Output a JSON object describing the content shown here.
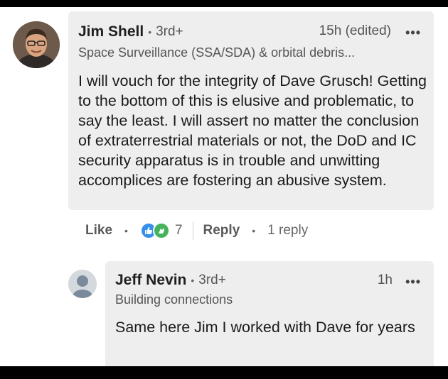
{
  "comment": {
    "author": "Jim Shell",
    "separator": "•",
    "degree": "3rd+",
    "time": "15h (edited)",
    "more": "•••",
    "headline": "Space Surveillance (SSA/SDA) & orbital debris...",
    "text": "I will vouch for the integrity of Dave Grusch! Getting to the bottom of this is elusive and problematic, to say the least. I will assert no matter the conclusion of extraterrestrial materials or not, the DoD and IC security apparatus is in trouble and unwitting accomplices are fostering an abusive system."
  },
  "actions": {
    "like_label": "Like",
    "separator": "•",
    "reaction_count": "7",
    "reply_label": "Reply",
    "replies_label": "1 reply"
  },
  "reply": {
    "author": "Jeff Nevin",
    "separator": "•",
    "degree": "3rd+",
    "time": "1h",
    "more": "•••",
    "headline": "Building connections",
    "text": "Same here Jim I worked with Dave for years"
  },
  "colors": {
    "like_reaction": "#378fe9",
    "celebrate_reaction": "#44b35b",
    "bubble_bg": "#eeeeee"
  }
}
